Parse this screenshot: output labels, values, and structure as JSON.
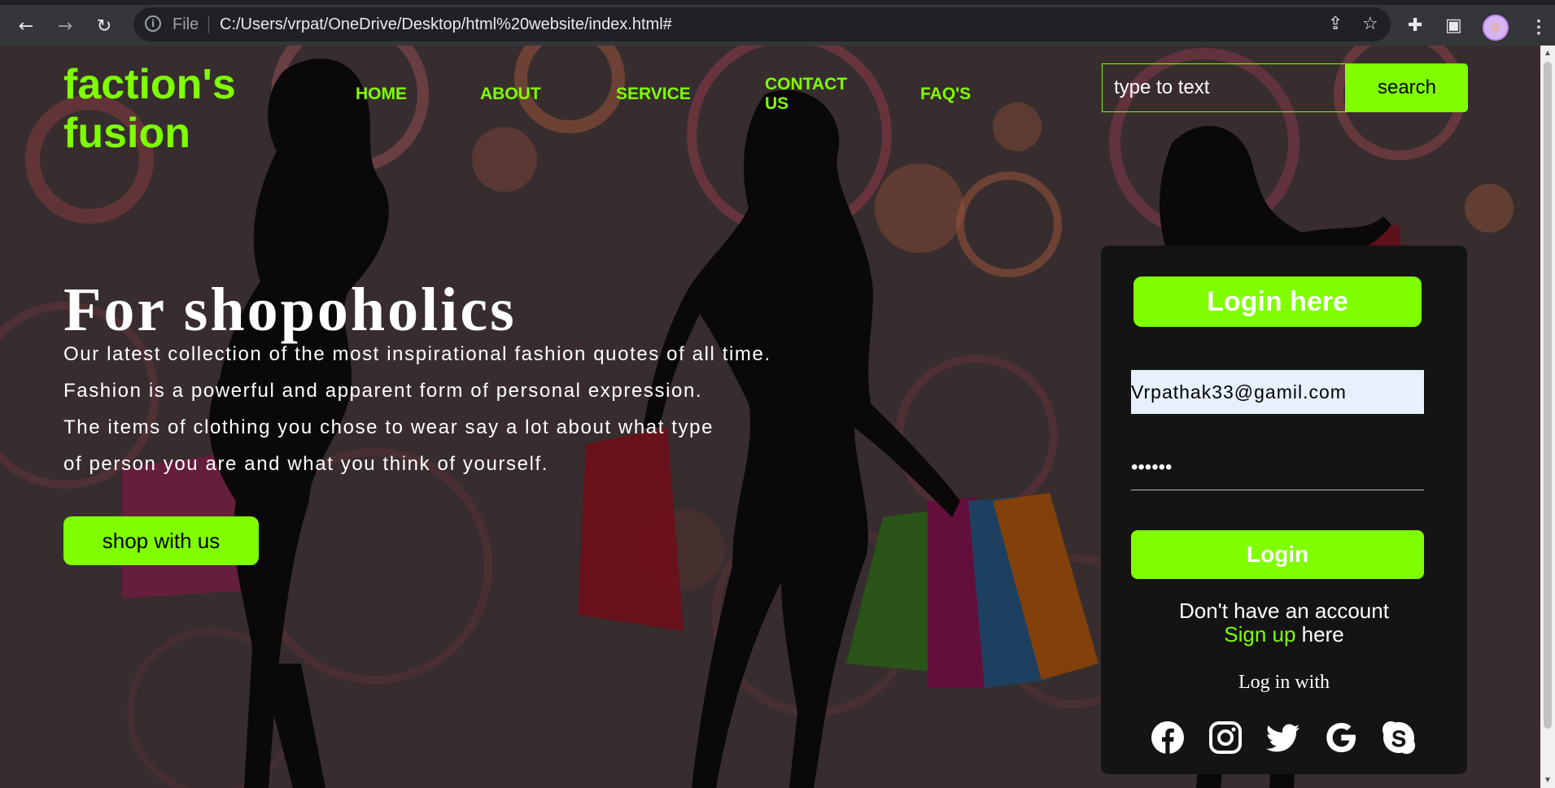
{
  "browser": {
    "file_label": "File",
    "url": "C:/Users/vrpat/OneDrive/Desktop/html%20website/index.html#",
    "icons": [
      "back-arrow-icon",
      "forward-arrow-icon",
      "reload-icon",
      "info-icon",
      "share-icon",
      "star-icon",
      "extensions-icon",
      "side-panel-icon",
      "profile-avatar",
      "menu-kebab-icon"
    ]
  },
  "site": {
    "logo": "faction's fusion",
    "nav": [
      {
        "label": "HOME"
      },
      {
        "label": "ABOUT"
      },
      {
        "label": "SERVICE"
      },
      {
        "label": "CONTACT US"
      },
      {
        "label": "FAQ'S"
      }
    ],
    "search": {
      "placeholder": "type to text",
      "button": "search"
    }
  },
  "hero": {
    "title": "For shopoholics",
    "lines": [
      "Our latest collection of the most inspirational fashion quotes of all time.",
      "Fashion is a powerful and apparent form of personal expression.",
      "The items of clothing you chose to wear say a lot about what type",
      "of person you are and what you think of yourself."
    ],
    "cta": "shop with us"
  },
  "login": {
    "title": "Login here",
    "email_value": "Vrpathak33@gamil.com",
    "password_value": "••••••",
    "button": "Login",
    "no_account": "Don't have an account",
    "signup_link": "Sign up",
    "signup_suffix": " here",
    "login_with": "Log in with",
    "socials": [
      "facebook-icon",
      "instagram-icon",
      "twitter-icon",
      "google-icon",
      "skype-icon"
    ]
  },
  "colors": {
    "accent": "#7fff00",
    "card_bg": "#141414",
    "chrome_bg": "#35363a"
  }
}
